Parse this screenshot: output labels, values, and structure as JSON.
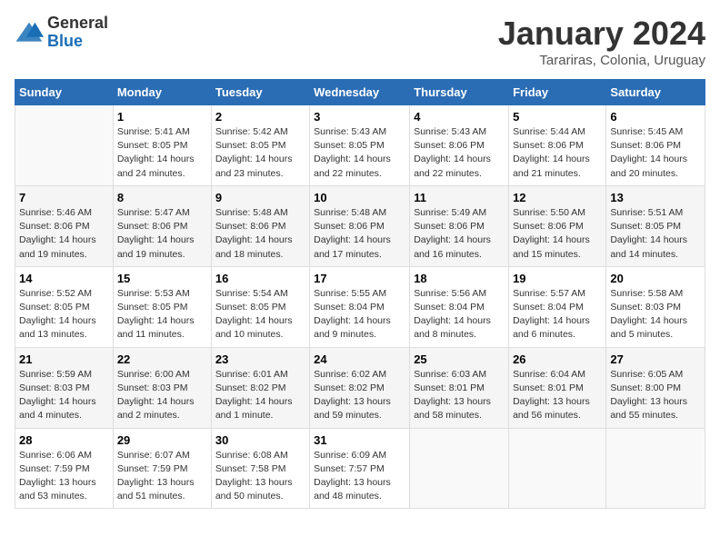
{
  "logo": {
    "general": "General",
    "blue": "Blue"
  },
  "title": "January 2024",
  "subtitle": "Tarariras, Colonia, Uruguay",
  "days_of_week": [
    "Sunday",
    "Monday",
    "Tuesday",
    "Wednesday",
    "Thursday",
    "Friday",
    "Saturday"
  ],
  "weeks": [
    [
      {
        "day": "",
        "info": ""
      },
      {
        "day": "1",
        "info": "Sunrise: 5:41 AM\nSunset: 8:05 PM\nDaylight: 14 hours\nand 24 minutes."
      },
      {
        "day": "2",
        "info": "Sunrise: 5:42 AM\nSunset: 8:05 PM\nDaylight: 14 hours\nand 23 minutes."
      },
      {
        "day": "3",
        "info": "Sunrise: 5:43 AM\nSunset: 8:05 PM\nDaylight: 14 hours\nand 22 minutes."
      },
      {
        "day": "4",
        "info": "Sunrise: 5:43 AM\nSunset: 8:06 PM\nDaylight: 14 hours\nand 22 minutes."
      },
      {
        "day": "5",
        "info": "Sunrise: 5:44 AM\nSunset: 8:06 PM\nDaylight: 14 hours\nand 21 minutes."
      },
      {
        "day": "6",
        "info": "Sunrise: 5:45 AM\nSunset: 8:06 PM\nDaylight: 14 hours\nand 20 minutes."
      }
    ],
    [
      {
        "day": "7",
        "info": "Sunrise: 5:46 AM\nSunset: 8:06 PM\nDaylight: 14 hours\nand 19 minutes."
      },
      {
        "day": "8",
        "info": "Sunrise: 5:47 AM\nSunset: 8:06 PM\nDaylight: 14 hours\nand 19 minutes."
      },
      {
        "day": "9",
        "info": "Sunrise: 5:48 AM\nSunset: 8:06 PM\nDaylight: 14 hours\nand 18 minutes."
      },
      {
        "day": "10",
        "info": "Sunrise: 5:48 AM\nSunset: 8:06 PM\nDaylight: 14 hours\nand 17 minutes."
      },
      {
        "day": "11",
        "info": "Sunrise: 5:49 AM\nSunset: 8:06 PM\nDaylight: 14 hours\nand 16 minutes."
      },
      {
        "day": "12",
        "info": "Sunrise: 5:50 AM\nSunset: 8:06 PM\nDaylight: 14 hours\nand 15 minutes."
      },
      {
        "day": "13",
        "info": "Sunrise: 5:51 AM\nSunset: 8:05 PM\nDaylight: 14 hours\nand 14 minutes."
      }
    ],
    [
      {
        "day": "14",
        "info": "Sunrise: 5:52 AM\nSunset: 8:05 PM\nDaylight: 14 hours\nand 13 minutes."
      },
      {
        "day": "15",
        "info": "Sunrise: 5:53 AM\nSunset: 8:05 PM\nDaylight: 14 hours\nand 11 minutes."
      },
      {
        "day": "16",
        "info": "Sunrise: 5:54 AM\nSunset: 8:05 PM\nDaylight: 14 hours\nand 10 minutes."
      },
      {
        "day": "17",
        "info": "Sunrise: 5:55 AM\nSunset: 8:04 PM\nDaylight: 14 hours\nand 9 minutes."
      },
      {
        "day": "18",
        "info": "Sunrise: 5:56 AM\nSunset: 8:04 PM\nDaylight: 14 hours\nand 8 minutes."
      },
      {
        "day": "19",
        "info": "Sunrise: 5:57 AM\nSunset: 8:04 PM\nDaylight: 14 hours\nand 6 minutes."
      },
      {
        "day": "20",
        "info": "Sunrise: 5:58 AM\nSunset: 8:03 PM\nDaylight: 14 hours\nand 5 minutes."
      }
    ],
    [
      {
        "day": "21",
        "info": "Sunrise: 5:59 AM\nSunset: 8:03 PM\nDaylight: 14 hours\nand 4 minutes."
      },
      {
        "day": "22",
        "info": "Sunrise: 6:00 AM\nSunset: 8:03 PM\nDaylight: 14 hours\nand 2 minutes."
      },
      {
        "day": "23",
        "info": "Sunrise: 6:01 AM\nSunset: 8:02 PM\nDaylight: 14 hours\nand 1 minute."
      },
      {
        "day": "24",
        "info": "Sunrise: 6:02 AM\nSunset: 8:02 PM\nDaylight: 13 hours\nand 59 minutes."
      },
      {
        "day": "25",
        "info": "Sunrise: 6:03 AM\nSunset: 8:01 PM\nDaylight: 13 hours\nand 58 minutes."
      },
      {
        "day": "26",
        "info": "Sunrise: 6:04 AM\nSunset: 8:01 PM\nDaylight: 13 hours\nand 56 minutes."
      },
      {
        "day": "27",
        "info": "Sunrise: 6:05 AM\nSunset: 8:00 PM\nDaylight: 13 hours\nand 55 minutes."
      }
    ],
    [
      {
        "day": "28",
        "info": "Sunrise: 6:06 AM\nSunset: 7:59 PM\nDaylight: 13 hours\nand 53 minutes."
      },
      {
        "day": "29",
        "info": "Sunrise: 6:07 AM\nSunset: 7:59 PM\nDaylight: 13 hours\nand 51 minutes."
      },
      {
        "day": "30",
        "info": "Sunrise: 6:08 AM\nSunset: 7:58 PM\nDaylight: 13 hours\nand 50 minutes."
      },
      {
        "day": "31",
        "info": "Sunrise: 6:09 AM\nSunset: 7:57 PM\nDaylight: 13 hours\nand 48 minutes."
      },
      {
        "day": "",
        "info": ""
      },
      {
        "day": "",
        "info": ""
      },
      {
        "day": "",
        "info": ""
      }
    ]
  ]
}
